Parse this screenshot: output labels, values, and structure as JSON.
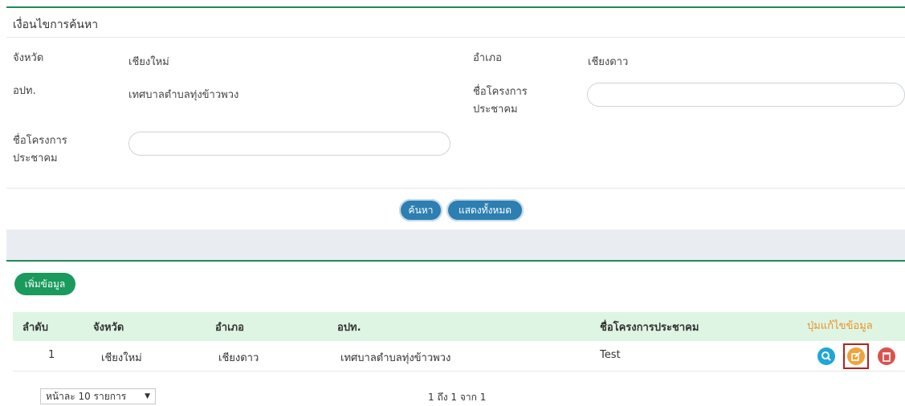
{
  "search_panel": {
    "title": "เงื่อนไขการค้นหา",
    "fields": {
      "province_label": "จังหวัด",
      "province_value": "เชียงใหม่",
      "district_label": "อำเภอ",
      "district_value": "เชียงดาว",
      "lao_label": "อปท.",
      "lao_value": "เทศบาลตำบลทุ่งข้าวพวง",
      "project_label_1": "ชื่อโครงการประชาคม",
      "project_label_2": "ชื่อโครงการประชาคม"
    },
    "search_button": "ค้นหา",
    "show_all_button": "แสดงทั้งหมด"
  },
  "list_panel": {
    "add_button": "เพิ่มข้อมูล",
    "columns": [
      "ลำดับ",
      "จังหวัด",
      "อำเภอ",
      "อปท.",
      "ชื่อโครงการประชาคม",
      "ปุ่มแก้ไขข้อมูล"
    ],
    "rows": [
      {
        "no": "1",
        "province": "เชียงใหม่",
        "district": "เชียงดาว",
        "lao": "เทศบาลตำบลทุ่งข้าวพวง",
        "project": "Test"
      }
    ],
    "page_size": "หน้าละ 10 รายการ",
    "summary": "1 ถึง 1 จาก 1"
  },
  "colors": {
    "accent_green": "#1e8a5a",
    "button_blue": "#2c7fb0",
    "edit_orange": "#f0a33a",
    "delete_red": "#d9534f",
    "view_blue": "#1ea6d8",
    "highlight_frame": "#b22222"
  },
  "icons": {
    "view": "search-icon",
    "edit": "edit-icon",
    "delete": "trash-icon",
    "dropdown": "chevron-down-icon"
  }
}
